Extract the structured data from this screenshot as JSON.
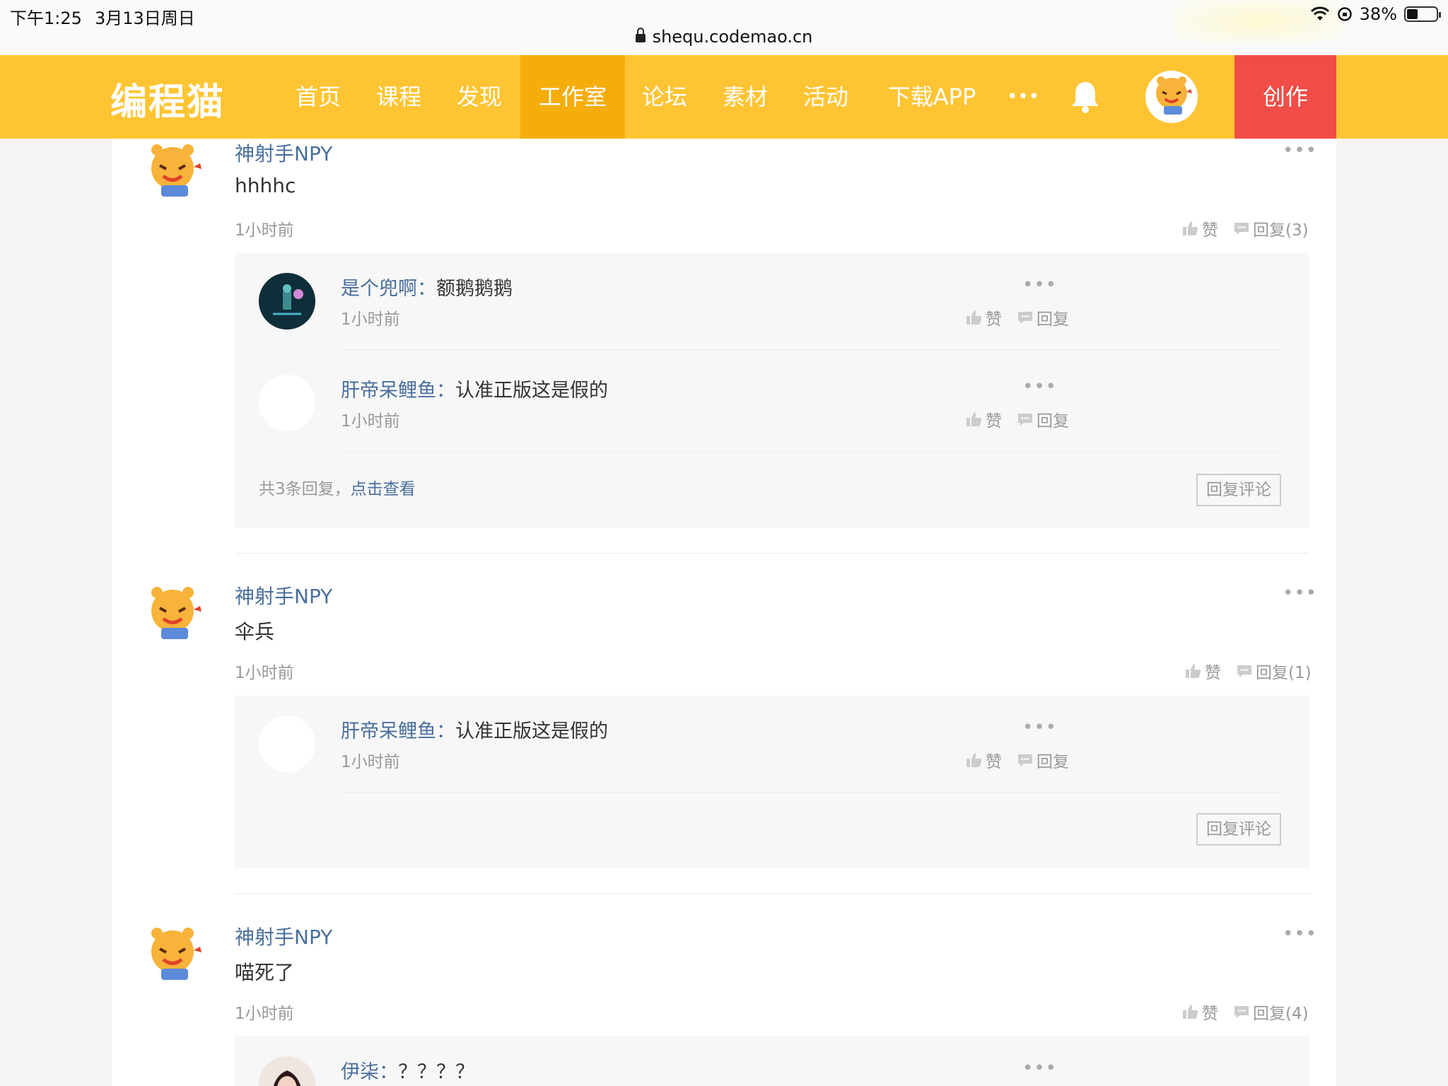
{
  "status_bar": {
    "time": "下午1:25",
    "date": "3月13日周日",
    "battery": "38%",
    "battery_level": 0.38,
    "url": "shequ.codemao.cn"
  },
  "nav": {
    "logo": "编程猫",
    "items": [
      "首页",
      "课程",
      "发现",
      "工作室",
      "论坛",
      "素材",
      "活动",
      "下载APP",
      "•••"
    ],
    "active_index": 3,
    "create": "创作",
    "colors": {
      "bar": "#fec433",
      "active": "#f5ad0c",
      "create": "#f04d46"
    }
  },
  "comments": [
    {
      "user": "神射手NPY",
      "text": "hhhhc",
      "time": "1小时前",
      "like": "赞",
      "reply": "回复(3)",
      "replies": [
        {
          "user": "是个兜啊",
          "text": "额鹅鹅鹅",
          "time": "1小时前",
          "like": "赞",
          "reply": "回复"
        },
        {
          "user": "肝帝呆鲤鱼",
          "text": "认准正版这是假的",
          "time": "1小时前",
          "like": "赞",
          "reply": "回复"
        }
      ],
      "total_prefix": "共3条回复，",
      "total_link": "点击查看",
      "reply_comment": "回复评论"
    },
    {
      "user": "神射手NPY",
      "text": "伞兵",
      "time": "1小时前",
      "like": "赞",
      "reply": "回复(1)",
      "replies": [
        {
          "user": "肝帝呆鲤鱼",
          "text": "认准正版这是假的",
          "time": "1小时前",
          "like": "赞",
          "reply": "回复"
        }
      ],
      "reply_comment": "回复评论"
    },
    {
      "user": "神射手NPY",
      "text": "喵死了",
      "time": "1小时前",
      "like": "赞",
      "reply": "回复(4)",
      "replies": [
        {
          "user": "伊柒",
          "text": "？？？？"
        }
      ]
    }
  ],
  "separator": "："
}
